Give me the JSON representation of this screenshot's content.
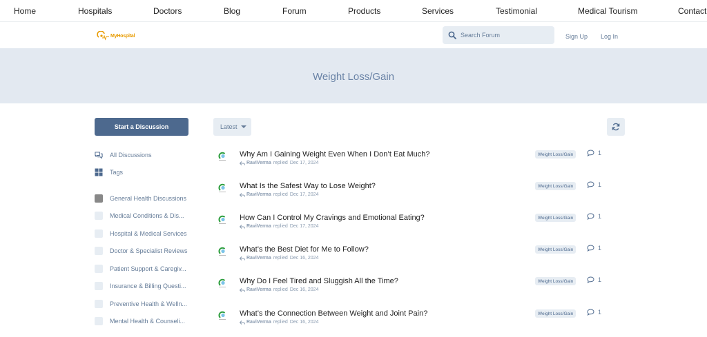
{
  "topnav": [
    "Home",
    "Hospitals",
    "Doctors",
    "Blog",
    "Forum",
    "Products",
    "Services",
    "Testimonial",
    "Medical Tourism",
    "Contact"
  ],
  "header": {
    "logo_text": "MyHospital",
    "search_placeholder": "Search Forum",
    "signup": "Sign Up",
    "login": "Log In"
  },
  "hero": {
    "title": "Weight Loss/Gain"
  },
  "sidebar": {
    "start_button": "Start a Discussion",
    "nav": [
      {
        "icon": "discussions-icon",
        "label": "All Discussions"
      },
      {
        "icon": "tags-icon",
        "label": "Tags"
      }
    ],
    "tags": [
      {
        "label": "General Health Discussions",
        "selected": true
      },
      {
        "label": "Medical Conditions & Dis..."
      },
      {
        "label": "Hospital & Medical Services"
      },
      {
        "label": "Doctor & Specialist Reviews"
      },
      {
        "label": "Patient Support & Caregiv..."
      },
      {
        "label": "Insurance & Billing Questi..."
      },
      {
        "label": "Preventive Health & Welln..."
      },
      {
        "label": "Mental Health & Counseli..."
      }
    ]
  },
  "toolbar": {
    "sort_label": "Latest"
  },
  "discussions": [
    {
      "title": "Why Am I Gaining Weight Even When I Don’t Eat Much?",
      "user": "RaviVerma",
      "action": "replied",
      "date": "Dec 17, 2024",
      "tag": "Weight Loss/Gain",
      "replies": "1"
    },
    {
      "title": "What Is the Safest Way to Lose Weight?",
      "user": "RaviVerma",
      "action": "replied",
      "date": "Dec 17, 2024",
      "tag": "Weight Loss/Gain",
      "replies": "1"
    },
    {
      "title": "How Can I Control My Cravings and Emotional Eating?",
      "user": "RaviVerma",
      "action": "replied",
      "date": "Dec 17, 2024",
      "tag": "Weight Loss/Gain",
      "replies": "1"
    },
    {
      "title": "What’s the Best Diet for Me to Follow?",
      "user": "RaviVerma",
      "action": "replied",
      "date": "Dec 16, 2024",
      "tag": "Weight Loss/Gain",
      "replies": "1"
    },
    {
      "title": "Why Do I Feel Tired and Sluggish All the Time?",
      "user": "RaviVerma",
      "action": "replied",
      "date": "Dec 16, 2024",
      "tag": "Weight Loss/Gain",
      "replies": "1"
    },
    {
      "title": "What’s the Connection Between Weight and Joint Pain?",
      "user": "RaviVerma",
      "action": "replied",
      "date": "Dec 16, 2024",
      "tag": "Weight Loss/Gain",
      "replies": "1"
    }
  ],
  "colors": {
    "primary": "#4d698e",
    "hero_bg": "#e3e9f1",
    "muted": "#667d99",
    "logo": "#e89b00"
  }
}
